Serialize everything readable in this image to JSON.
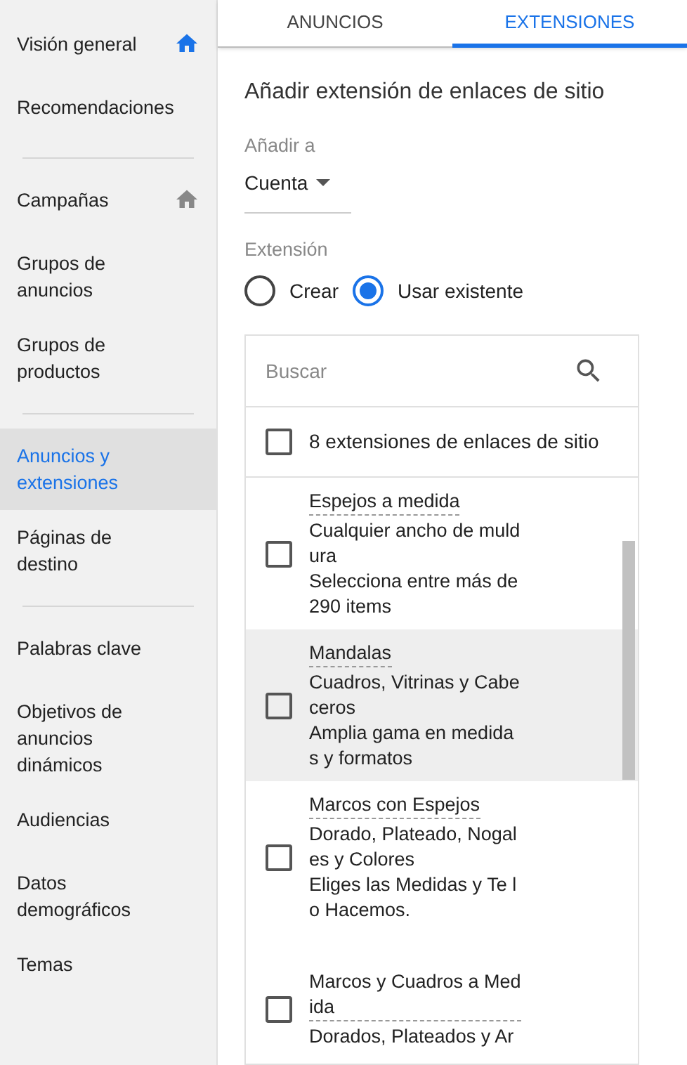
{
  "sidebar": {
    "groups": [
      {
        "items": [
          {
            "label": "Visión general",
            "selected": false,
            "icon_active": true
          },
          {
            "label": "Recomendaciones",
            "selected": false
          }
        ]
      },
      {
        "items": [
          {
            "label": "Campañas",
            "selected": false,
            "icon_active": false
          },
          {
            "label": "Grupos de anuncios",
            "selected": false
          },
          {
            "label": "Grupos de productos",
            "selected": false
          }
        ]
      },
      {
        "items": [
          {
            "label": "Anuncios y extensiones",
            "selected": true
          },
          {
            "label": "Páginas de destino",
            "selected": false
          }
        ]
      },
      {
        "items": [
          {
            "label": "Palabras clave",
            "selected": false
          },
          {
            "label": "Objetivos de anuncios dinámicos",
            "selected": false
          },
          {
            "label": "Audiencias",
            "selected": false
          },
          {
            "label": "Datos demográficos",
            "selected": false
          },
          {
            "label": "Temas",
            "selected": false
          }
        ]
      }
    ]
  },
  "tabs": [
    {
      "label": "ANUNCIOS",
      "selected": false
    },
    {
      "label": "EXTENSIONES",
      "selected": true
    }
  ],
  "heading": "Añadir extensión de enlaces de sitio",
  "add_to": {
    "label": "Añadir a",
    "value": "Cuenta"
  },
  "extension": {
    "label": "Extensión",
    "options": [
      {
        "label": "Crear",
        "selected": false
      },
      {
        "label": "Usar existente",
        "selected": true
      }
    ]
  },
  "picker": {
    "search": {
      "placeholder": "Buscar"
    },
    "select_all": {
      "label": "8 extensiones de enlaces de sitio",
      "checked": false
    },
    "items": [
      {
        "title_lines": [
          "Espejos a medida"
        ],
        "lines": [
          "Cualquier ancho de muld",
          "ura",
          "Selecciona entre más de",
          "290 items"
        ],
        "checked": false,
        "highlighted": false
      },
      {
        "title_lines": [
          "Mandalas"
        ],
        "lines": [
          "Cuadros, Vitrinas y Cabe",
          "ceros",
          "Amplia gama en medida",
          "s y formatos"
        ],
        "checked": false,
        "highlighted": true
      },
      {
        "title_lines": [
          "Marcos con Espejos"
        ],
        "lines": [
          "Dorado, Plateado, Nogal",
          "es y Colores",
          "Eliges las Medidas y Te l",
          "o Hacemos."
        ],
        "checked": false,
        "highlighted": false
      },
      {
        "title_lines": [
          "Marcos y Cuadros a Med",
          "ida"
        ],
        "lines": [
          "Dorados, Plateados y Ar"
        ],
        "checked": false,
        "highlighted": false
      }
    ]
  }
}
